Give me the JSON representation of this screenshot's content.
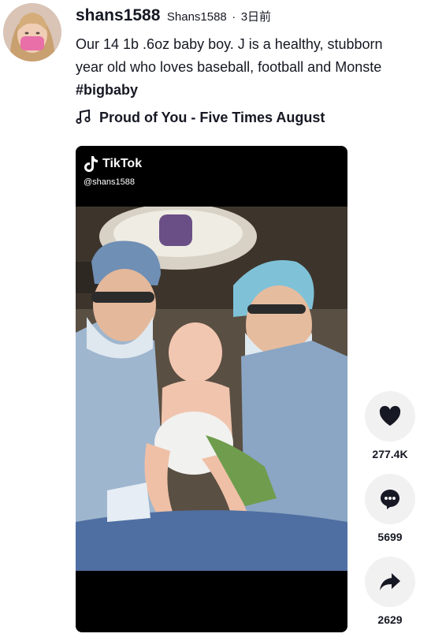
{
  "author": {
    "username": "shans1588",
    "nickname": "Shans1588",
    "separator": "·",
    "posted_ago": "3日前"
  },
  "caption": {
    "line1": "Our 14 1b .6oz baby boy. J is a healthy, stubborn",
    "line2": "year old who loves baseball, football and Monste",
    "hashtag": "#bigbaby"
  },
  "music": {
    "title": "Proud of You - Five Times August",
    "icon": "music-note-icon"
  },
  "video": {
    "watermark_brand": "TikTok",
    "watermark_handle": "@shans1588"
  },
  "actions": {
    "like_count": "277.4K",
    "comment_count": "5699",
    "share_count": "2629"
  },
  "colors": {
    "text": "#161823",
    "action_bg": "#f1f1f2",
    "video_bg": "#000000"
  }
}
